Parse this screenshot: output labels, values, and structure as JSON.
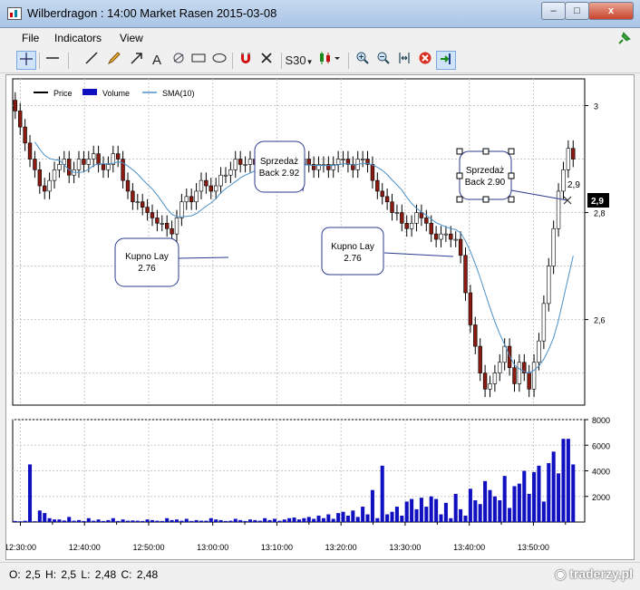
{
  "window": {
    "title": "Wilberdragon : 14:00 Market Rasen 2015-03-08",
    "minimize_glyph": "–",
    "maximize_glyph": "□",
    "close_glyph": "x"
  },
  "menu": {
    "items": [
      "File",
      "Indicators",
      "View"
    ]
  },
  "toolbar": {
    "interval_label": "S30",
    "tools": [
      "crosshair-icon",
      "horizontal-line-icon",
      "trend-line-icon",
      "pencil-icon",
      "arrow-icon",
      "text-icon",
      "fibonacci-icon",
      "rectangle-icon",
      "ellipse-icon",
      "magnet-icon",
      "delete-icon"
    ],
    "zoom_tools": [
      "zoom-in-icon",
      "zoom-out-icon",
      "fit-icon",
      "clear-icon",
      "scroll-to-end-icon"
    ]
  },
  "legend": {
    "price": "Price",
    "volume": "Volume",
    "sma": "SMA(10)"
  },
  "annotations": {
    "kupno1_line1": "Kupno Lay",
    "kupno1_line2": "2.76",
    "sprzedaz1_line1": "Sprzedaż",
    "sprzedaz1_line2": "Back 2.92",
    "kupno2_line1": "Kupno Lay",
    "kupno2_line2": "2.76",
    "sprzedaz2_line1": "Sprzedaż",
    "sprzedaz2_line2": "Back 2.90",
    "last_price_tag": "2,9",
    "top_price_text": "2,9"
  },
  "status": {
    "o_label": "O:",
    "o_value": "2,5",
    "h_label": "H:",
    "h_value": "2,5",
    "l_label": "L:",
    "l_value": "2,48",
    "c_label": "C:",
    "c_value": "2,48",
    "watermark": "traderzy.pl"
  },
  "colors": {
    "up": "#ffffff",
    "down": "#8b1a10",
    "volume": "#1010c0",
    "sma": "#4a90c8",
    "annotation_border": "#2b3b8f"
  },
  "chart_data": [
    {
      "type": "candlestick",
      "title": "",
      "xlabel": "",
      "ylabel": "",
      "ylim": [
        2.44,
        3.05
      ],
      "yticks": [
        "3",
        "2,8",
        "2,6"
      ],
      "ytick_values": [
        3.0,
        2.8,
        2.6
      ],
      "xticks": [
        "12:30:00",
        "12:40:00",
        "12:50:00",
        "13:00:00",
        "13:10:00",
        "13:20:00",
        "13:30:00",
        "13:40:00",
        "13:50:00"
      ],
      "xtick_minutes": [
        0,
        10,
        20,
        30,
        40,
        50,
        60,
        70,
        80
      ],
      "x_start_minute": -1.2,
      "x_end_minute": 88.0,
      "close": [
        2.99,
        2.96,
        2.93,
        2.9,
        2.88,
        2.85,
        2.84,
        2.86,
        2.88,
        2.89,
        2.9,
        2.87,
        2.88,
        2.9,
        2.89,
        2.9,
        2.91,
        2.89,
        2.88,
        2.89,
        2.91,
        2.9,
        2.86,
        2.84,
        2.82,
        2.82,
        2.81,
        2.8,
        2.79,
        2.78,
        2.78,
        2.77,
        2.76,
        2.79,
        2.82,
        2.83,
        2.82,
        2.84,
        2.86,
        2.85,
        2.84,
        2.85,
        2.87,
        2.87,
        2.88,
        2.9,
        2.89,
        2.89,
        2.9,
        2.89,
        2.89,
        2.89,
        2.89,
        2.89,
        2.88,
        2.89,
        2.89,
        2.88,
        2.89,
        2.9,
        2.89,
        2.88,
        2.89,
        2.89,
        2.88,
        2.89,
        2.9,
        2.9,
        2.89,
        2.88,
        2.9,
        2.9,
        2.89,
        2.86,
        2.84,
        2.83,
        2.82,
        2.8,
        2.8,
        2.78,
        2.77,
        2.78,
        2.8,
        2.79,
        2.78,
        2.76,
        2.75,
        2.76,
        2.76,
        2.75,
        2.75,
        2.72,
        2.65,
        2.59,
        2.55,
        2.5,
        2.47,
        2.48,
        2.5,
        2.52,
        2.55,
        2.51,
        2.48,
        2.52,
        2.5,
        2.47,
        2.52,
        2.56,
        2.63,
        2.7,
        2.77,
        2.84,
        2.88,
        2.92,
        2.9
      ],
      "series_name": "Price",
      "sma_name": "SMA(10)"
    },
    {
      "type": "bar",
      "series_name": "Volume",
      "ylim": [
        0,
        8000
      ],
      "yticks": [
        "8000",
        "6000",
        "4000",
        "2000"
      ],
      "ytick_values": [
        8000,
        6000,
        4000,
        2000
      ],
      "values": [
        80,
        60,
        100,
        4500,
        60,
        900,
        700,
        300,
        200,
        200,
        120,
        400,
        100,
        150,
        80,
        300,
        100,
        200,
        80,
        150,
        300,
        80,
        200,
        100,
        120,
        100,
        80,
        200,
        150,
        100,
        80,
        300,
        150,
        200,
        100,
        250,
        80,
        150,
        100,
        100,
        300,
        200,
        150,
        80,
        100,
        250,
        150,
        80,
        200,
        150,
        100,
        300,
        150,
        250,
        100,
        200,
        300,
        350,
        200,
        300,
        400,
        250,
        500,
        300,
        600,
        250,
        700,
        800,
        500,
        900,
        400,
        1200,
        600,
        2500,
        300,
        4400,
        600,
        800,
        1200,
        500,
        1600,
        1800,
        1000,
        1900,
        1200,
        2000,
        1800,
        600,
        1500,
        300,
        2200,
        1000,
        500,
        2600,
        1700,
        1400,
        3200,
        2500,
        2000,
        1700,
        3600,
        1100,
        2800,
        3000,
        4000,
        2200,
        3900,
        4400,
        1600,
        4600,
        5500,
        3800,
        6500,
        6500,
        4500
      ]
    }
  ]
}
